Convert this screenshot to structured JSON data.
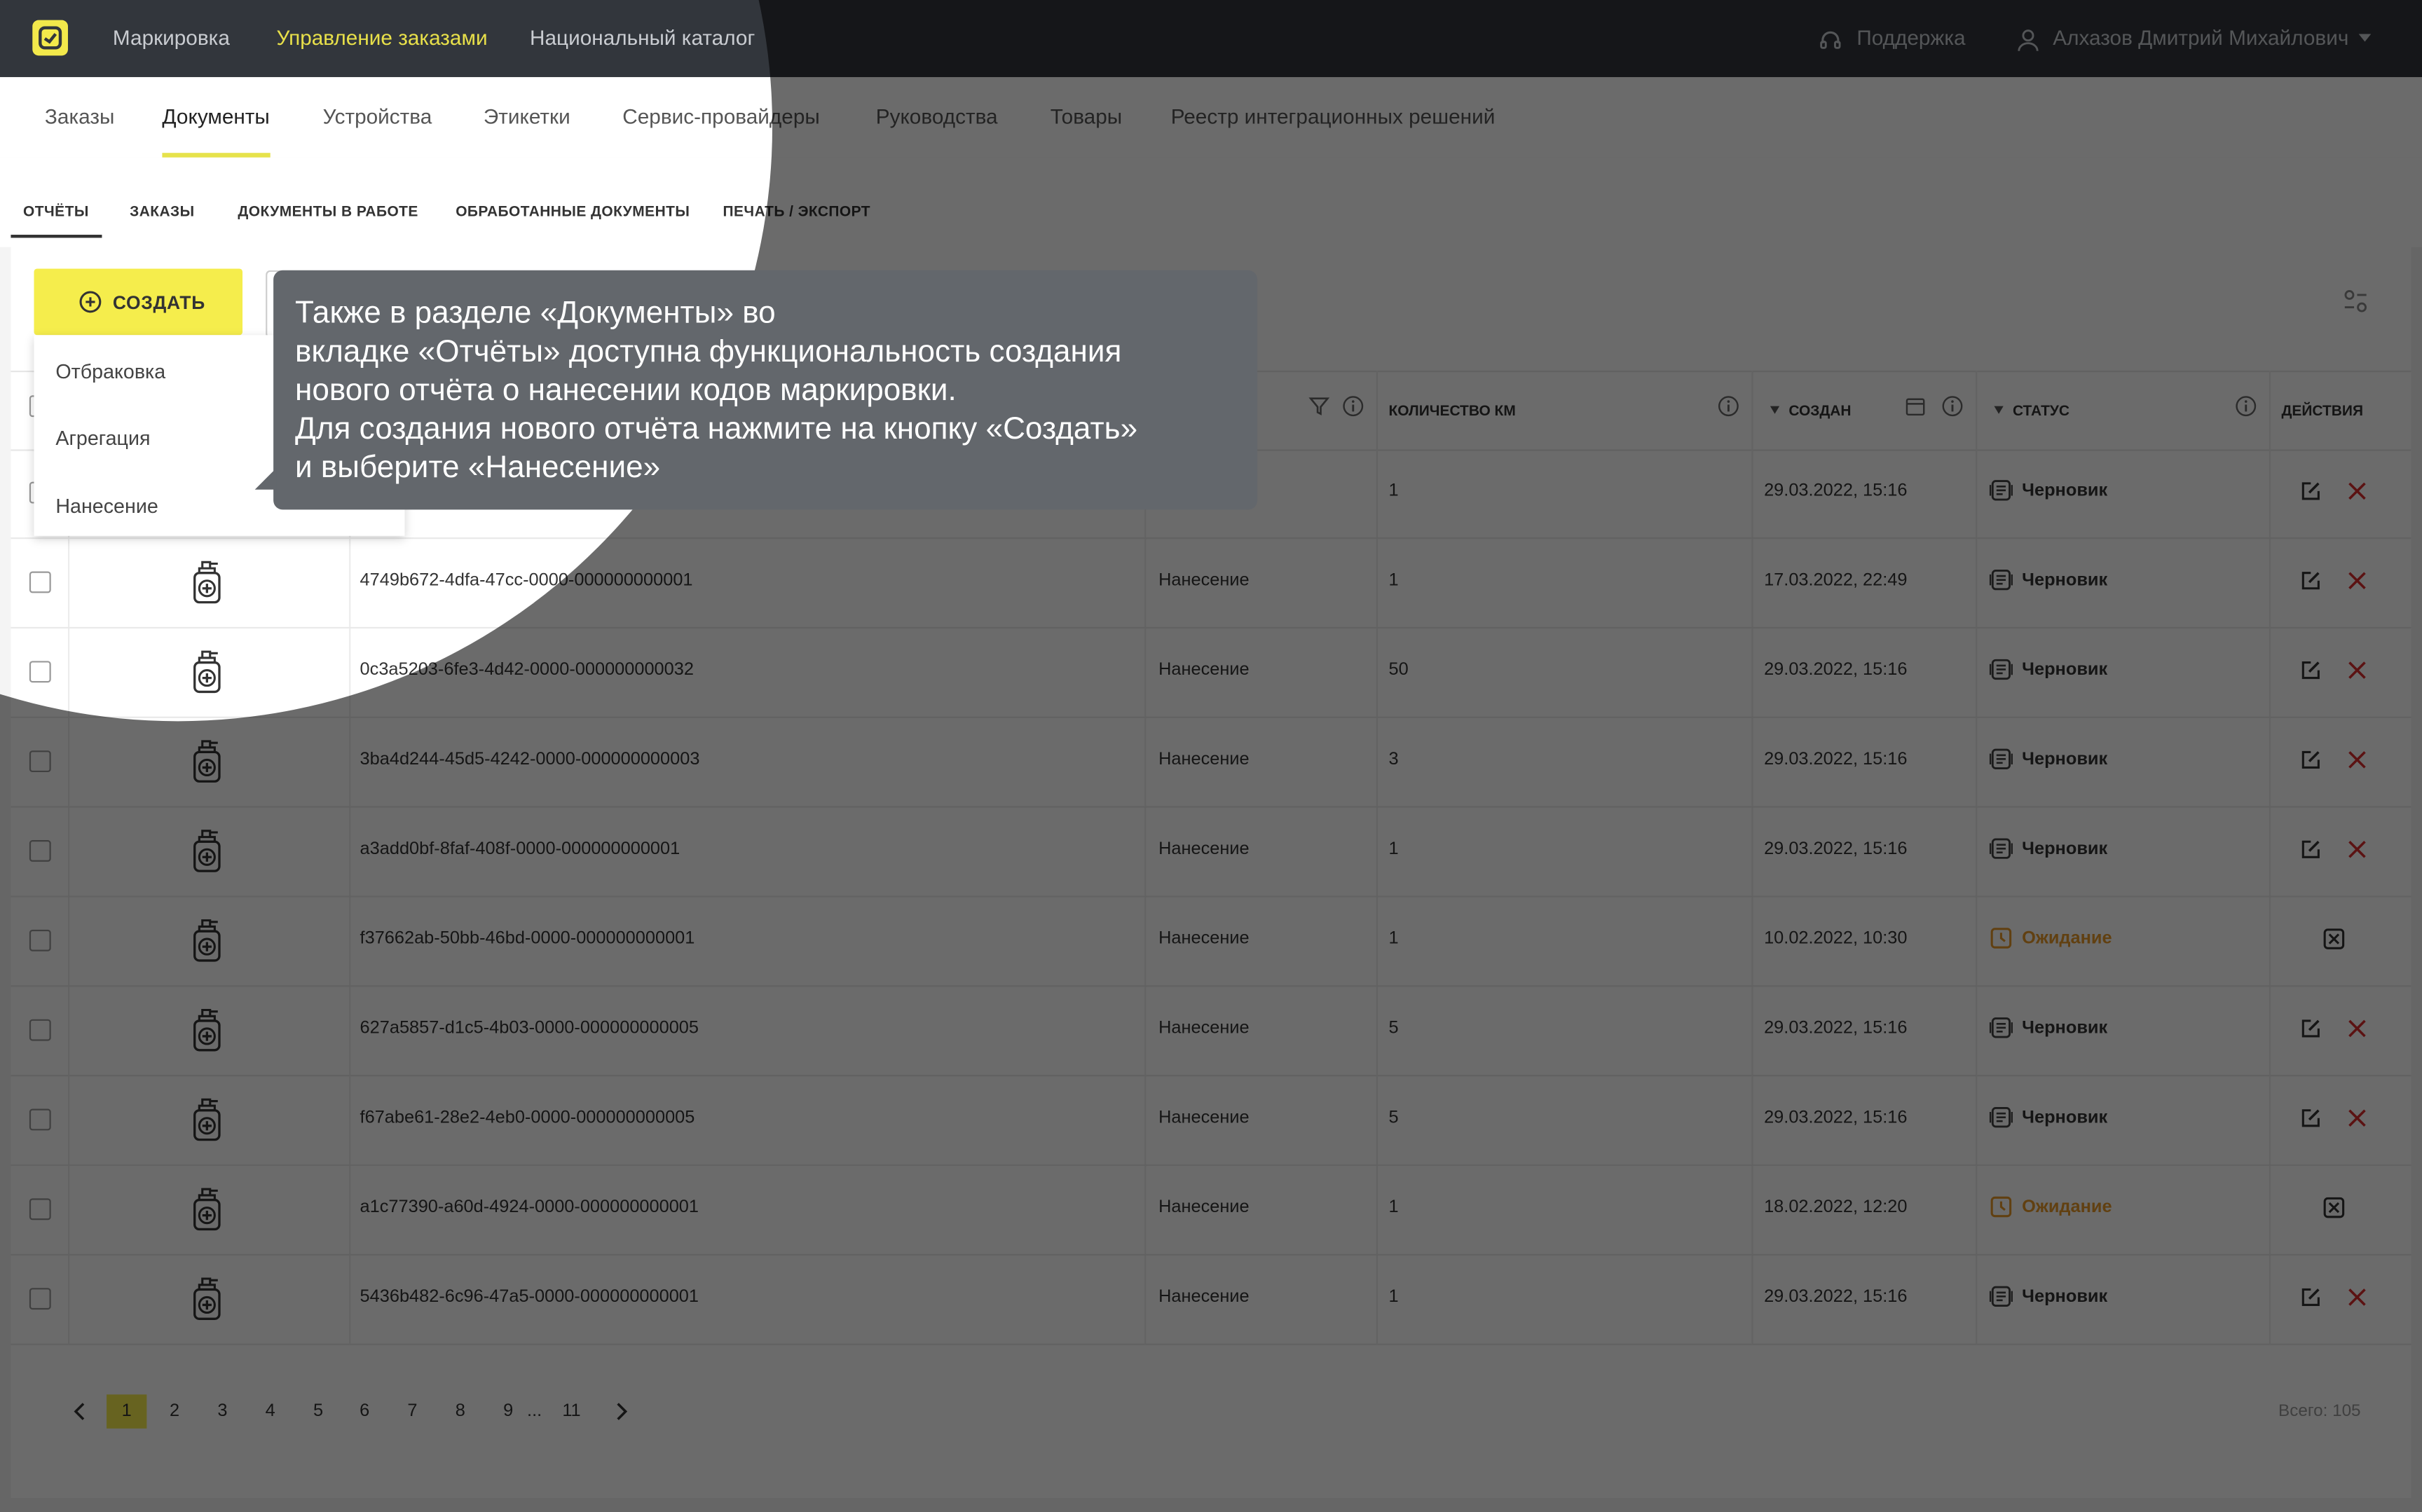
{
  "topbar": {
    "nav": [
      "Маркировка",
      "Управление заказами",
      "Национальный каталог"
    ],
    "support": "Поддержка",
    "user": "Алхазов Дмитрий Михайлович"
  },
  "tabs": [
    "Заказы",
    "Документы",
    "Устройства",
    "Этикетки",
    "Сервис-провайдеры",
    "Руководства",
    "Товары",
    "Реестр интеграционных решений"
  ],
  "subtabs": [
    "ОТЧЁТЫ",
    "ЗАКАЗЫ",
    "ДОКУМЕНТЫ В РАБОТЕ",
    "ОБРАБОТАННЫЕ ДОКУМЕНТЫ",
    "ПЕЧАТЬ / ЭКСПОРТ"
  ],
  "toolbar": {
    "create": "СОЗДАТЬ"
  },
  "dropdown": [
    "Отбраковка",
    "Агрегация",
    "Нанесение"
  ],
  "table": {
    "headers": {
      "qty": "КОЛИЧЕСТВО КМ",
      "created": "СОЗДАН",
      "status": "СТАТУС",
      "actions": "ДЕЙСТВИЯ"
    },
    "rows": [
      {
        "id": "",
        "type": "",
        "qty": "1",
        "date": "29.03.2022, 15:16",
        "status": "Черновик",
        "state": "draft"
      },
      {
        "id": "4749b672-4dfa-47cc-0000-000000000001",
        "type": "Нанесение",
        "qty": "1",
        "date": "17.03.2022, 22:49",
        "status": "Черновик",
        "state": "draft"
      },
      {
        "id": "0c3a5203-6fe3-4d42-0000-000000000032",
        "type": "Нанесение",
        "qty": "50",
        "date": "29.03.2022, 15:16",
        "status": "Черновик",
        "state": "draft"
      },
      {
        "id": "3ba4d244-45d5-4242-0000-000000000003",
        "type": "Нанесение",
        "qty": "3",
        "date": "29.03.2022, 15:16",
        "status": "Черновик",
        "state": "draft"
      },
      {
        "id": "a3add0bf-8faf-408f-0000-000000000001",
        "type": "Нанесение",
        "qty": "1",
        "date": "29.03.2022, 15:16",
        "status": "Черновик",
        "state": "draft"
      },
      {
        "id": "f37662ab-50bb-46bd-0000-000000000001",
        "type": "Нанесение",
        "qty": "1",
        "date": "10.02.2022, 10:30",
        "status": "Ожидание",
        "state": "wait"
      },
      {
        "id": "627a5857-d1c5-4b03-0000-000000000005",
        "type": "Нанесение",
        "qty": "5",
        "date": "29.03.2022, 15:16",
        "status": "Черновик",
        "state": "draft"
      },
      {
        "id": "f67abe61-28e2-4eb0-0000-000000000005",
        "type": "Нанесение",
        "qty": "5",
        "date": "29.03.2022, 15:16",
        "status": "Черновик",
        "state": "draft"
      },
      {
        "id": "a1c77390-a60d-4924-0000-000000000001",
        "type": "Нанесение",
        "qty": "1",
        "date": "18.02.2022, 12:20",
        "status": "Ожидание",
        "state": "wait"
      },
      {
        "id": "5436b482-6c96-47a5-0000-000000000001",
        "type": "Нанесение",
        "qty": "1",
        "date": "29.03.2022, 15:16",
        "status": "Черновик",
        "state": "draft"
      }
    ]
  },
  "pagination": {
    "pages": [
      "1",
      "2",
      "3",
      "4",
      "5",
      "6",
      "7",
      "8",
      "9",
      "...",
      "11"
    ],
    "current": "1",
    "total": "Всего: 105"
  },
  "tooltip": {
    "lines": [
      "Также в разделе «Документы» во",
      "вкладке «Отчёты» доступна функциональность создания",
      "нового отчёта о нанесении кодов маркировки.",
      "Для создания нового отчёта нажмите на кнопку «Создать»",
      "и выберите «Нанесение»"
    ]
  },
  "colors": {
    "accent": "#f5ed4c",
    "topbar": "#32363c",
    "wait": "#e89a2a",
    "delete": "#d92b2b"
  }
}
